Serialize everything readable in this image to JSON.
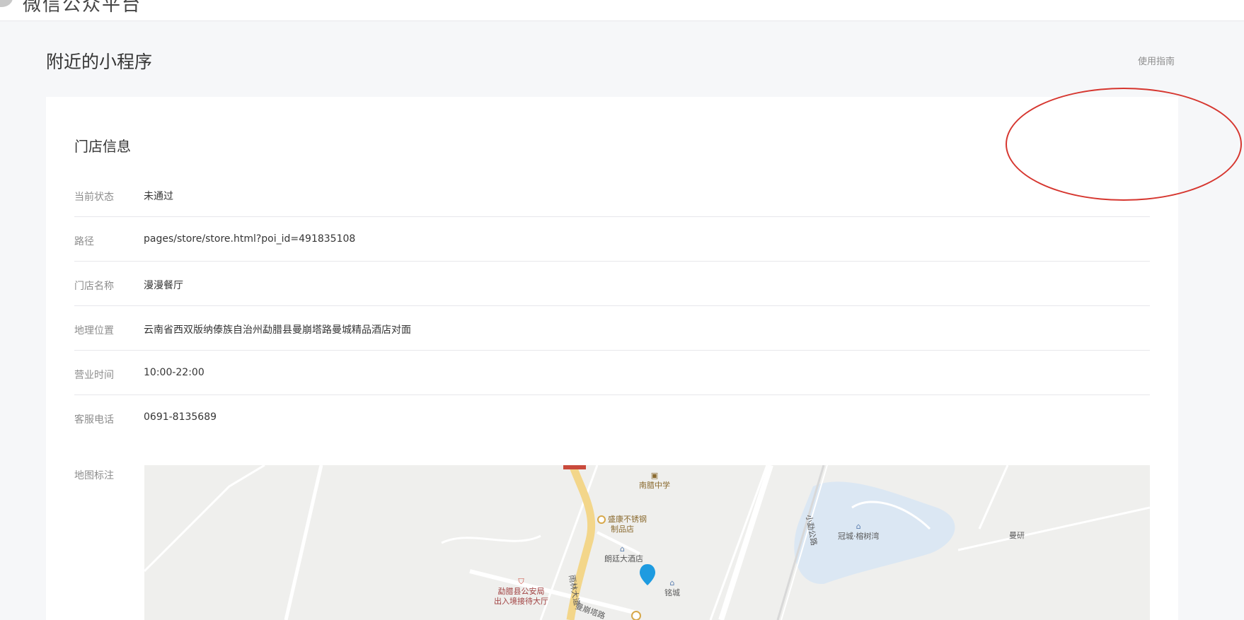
{
  "header": {
    "brand": "微信公众平台"
  },
  "page": {
    "title": "附近的小程序",
    "guide_link": "使用指南"
  },
  "store": {
    "section_title": "门店信息",
    "rows": [
      {
        "label": "当前状态",
        "value": "未通过"
      },
      {
        "label": "路径",
        "value": "pages/store/store.html?poi_id=491835108"
      },
      {
        "label": "门店名称",
        "value": "漫漫餐厅"
      },
      {
        "label": "地理位置",
        "value": "云南省西双版纳傣族自治州勐腊县曼崩塔路曼城精品酒店对面"
      },
      {
        "label": "营业时间",
        "value": "10:00-22:00"
      },
      {
        "label": "客服电话",
        "value": "0691-8135689"
      }
    ],
    "map_label": "地图标注"
  },
  "map": {
    "pois": {
      "school": "南腊中学",
      "shop_line1": "盛康不锈钢",
      "shop_line2": "制品店",
      "hotel": "朗廷大酒店",
      "police_line1": "勐腊县公安局",
      "police_line2": "出入境接待大厅",
      "mingcheng": "铭城",
      "guancheng": "冠城·榕树湾",
      "manyan": "曼研",
      "road_manbeng": "曼崩塔路",
      "road_yulin": "雨林大道",
      "road_xiaomeng": "小勐公路"
    },
    "colors": {
      "marker": "#1e9be0",
      "main_road": "#f3d68a",
      "water": "#dbe7f3"
    }
  }
}
